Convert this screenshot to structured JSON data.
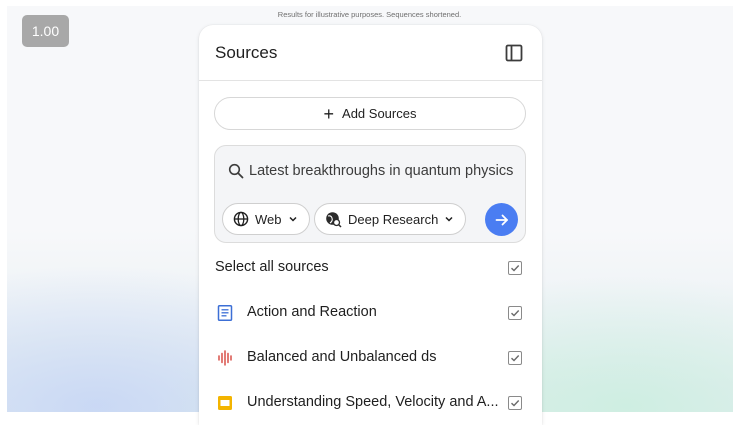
{
  "zoom": {
    "level": "1.00"
  },
  "disclaimer": "Results for illustrative purposes. Sequences shortened.",
  "panel": {
    "title": "Sources",
    "toggle_icon": "side-panel-icon",
    "add_sources_label": "Add Sources",
    "query": {
      "text": "Latest breakthroughs in quantum physics",
      "search_icon": "search-icon"
    },
    "chips": {
      "web_label": "Web",
      "research_label": "Deep Research"
    },
    "submit_icon": "arrow-right-icon",
    "select_all_label": "Select all sources",
    "sources": [
      {
        "label": "Action and Reaction",
        "icon": "document-icon",
        "checked": true
      },
      {
        "label": "Balanced and Unbalanced ds",
        "icon": "audio-waveform-icon",
        "checked": true
      },
      {
        "label": "Understanding Speed, Velocity and A...",
        "icon": "slides-icon",
        "checked": true
      }
    ]
  },
  "colors": {
    "accent": "#4a7df2",
    "document_icon": "#3c6fd6",
    "audio_icon": "#d6453d",
    "slides_icon": "#f3b400"
  }
}
